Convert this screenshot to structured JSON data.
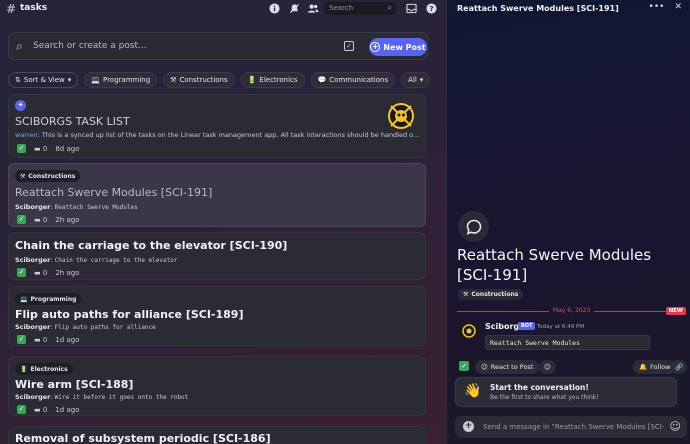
{
  "header": {
    "channel": "tasks",
    "search_placeholder": "Search"
  },
  "search": {
    "placeholder": "Search or create a post...",
    "new_post_label": "New Post"
  },
  "filters": {
    "sort_label": "Sort & View",
    "tags": [
      {
        "icon": "💻",
        "label": "Programming"
      },
      {
        "icon": "⚒",
        "label": "Constructions"
      },
      {
        "icon": "🔋",
        "label": "Electronics"
      },
      {
        "icon": "💬",
        "label": "Communications"
      }
    ],
    "all_label": "All"
  },
  "posts": [
    {
      "title": "SCIBORGS TASK LIST",
      "author": "warren",
      "snippet": "This is a synced up list of the tasks on the Linear task management app. All task interactions should be handled o...",
      "replies": "0",
      "time": "8d ago"
    },
    {
      "tag": "Constructions",
      "tag_icon": "⚒",
      "title": "Reattach Swerve Modules [SCI-191]",
      "author": "Sciborger",
      "snippet": "Reattach Swerve Modules",
      "replies": "0",
      "time": "2h ago"
    },
    {
      "title": "Chain the carriage to the elevator [SCI-190]",
      "author": "Sciborger",
      "snippet": "Chain the carriage to the elevator",
      "replies": "0",
      "time": "2h ago"
    },
    {
      "tag": "Programming",
      "tag_icon": "💻",
      "title": "Flip auto paths for alliance [SCI-189]",
      "author": "Sciborger",
      "snippet": "Flip auto paths for alliance",
      "replies": "0",
      "time": "1d ago"
    },
    {
      "tag": "Electronics",
      "tag_icon": "🔋",
      "title": "Wire arm [SCI-188]",
      "author": "Sciborger",
      "snippet": "Wire it before it goes onto the robot",
      "replies": "0",
      "time": "1d ago"
    },
    {
      "title": "Removal of subsystem periodic [SCI-186]"
    }
  ],
  "thread": {
    "header_title": "Reattach Swerve Modules [SCI-191]",
    "title": "Reattach Swerve Modules [SCI-191]",
    "tag": "Constructions",
    "date_divider": "May 6, 2023",
    "new_badge": "NEW",
    "message": {
      "author": "Sciborger",
      "bot_badge": "BOT",
      "time": "Today at 6:49 PM",
      "content": "Reattach Swerve Modules"
    },
    "react_label": "React to Post",
    "follow_label": "Follow",
    "start_title": "Start the conversation!",
    "start_subtitle": "Be the first to share what you think!",
    "composer_placeholder": "Send a message in \"Reattach Swerve Modules [SCI-191]\""
  },
  "colors": {
    "accent": "#5865f2",
    "check": "#3ba55c",
    "new": "#e03a4e"
  }
}
